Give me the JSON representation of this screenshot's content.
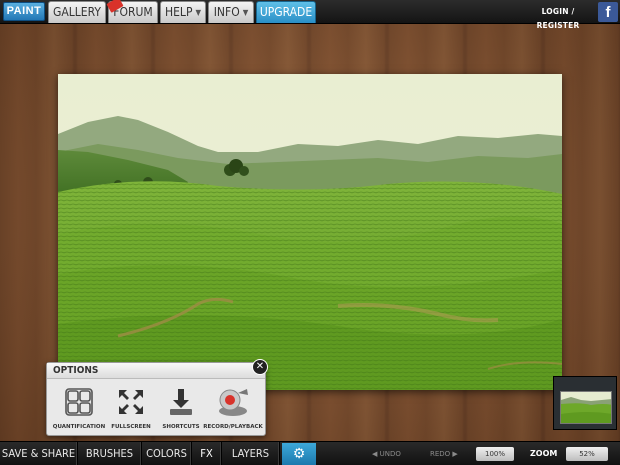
{
  "nav": {
    "logo": "PAINT",
    "items": [
      {
        "label": "GALLERY"
      },
      {
        "label": "FORUM"
      },
      {
        "label": "HELP"
      },
      {
        "label": "INFO"
      },
      {
        "label": "UPGRADE"
      }
    ],
    "login_label": "LOGIN / REGISTER",
    "facebook": "f"
  },
  "options_panel": {
    "title": "OPTIONS",
    "close": "✕",
    "buttons": [
      {
        "label": "QUANTIFICATION",
        "icon": "grid-icon"
      },
      {
        "label": "FULLSCREEN",
        "icon": "fullscreen-icon"
      },
      {
        "label": "SHORTCUTS",
        "icon": "download-icon"
      },
      {
        "label": "RECORD/PLAYBACK",
        "icon": "record-icon"
      }
    ]
  },
  "toolbar": {
    "save_share": "SAVE & SHARE",
    "brushes": "BRUSHES",
    "colors": "COLORS",
    "fx": "FX",
    "layers": "LAYERS",
    "settings_icon": "gear-icon",
    "undo": "UNDO",
    "redo": "REDO",
    "undo_percent": "100%",
    "zoom_label": "ZOOM",
    "zoom_value": "52%"
  },
  "colors": {
    "accent": "#2a8fc6",
    "facebook": "#3b5998"
  }
}
